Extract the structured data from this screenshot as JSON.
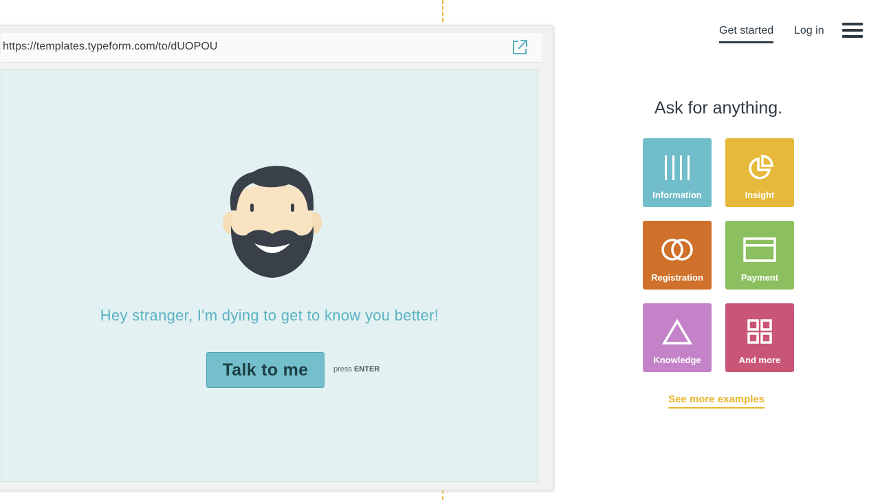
{
  "browser": {
    "url": "https://templates.typeform.com/to/dUOPOU",
    "external_icon": "external-link-icon"
  },
  "form": {
    "greeting": "Hey stranger, I'm dying to get to know you better!",
    "button_label": "Talk to me",
    "press_label": "press",
    "press_key": "ENTER"
  },
  "nav": {
    "get_started": "Get started",
    "login": "Log in",
    "menu_icon": "hamburger-menu-icon"
  },
  "sidebar": {
    "tagline": "Ask for anything.",
    "tiles": [
      {
        "label": "Information",
        "icon": "bars-icon",
        "color": "#72bdca"
      },
      {
        "label": "Insight",
        "icon": "pie-chart-icon",
        "color": "#e6b93b"
      },
      {
        "label": "Registration",
        "icon": "rings-icon",
        "color": "#cf712a"
      },
      {
        "label": "Payment",
        "icon": "card-icon",
        "color": "#8cbf5f"
      },
      {
        "label": "Knowledge",
        "icon": "triangle-icon",
        "color": "#c483c9"
      },
      {
        "label": "And more",
        "icon": "grid-icon",
        "color": "#c95676"
      }
    ],
    "see_more": "See more examples"
  },
  "colors": {
    "accent": "#e7b52c",
    "form_background": "#e3f1f3",
    "form_text": "#5bb2c2",
    "button": "#74bfcb"
  }
}
